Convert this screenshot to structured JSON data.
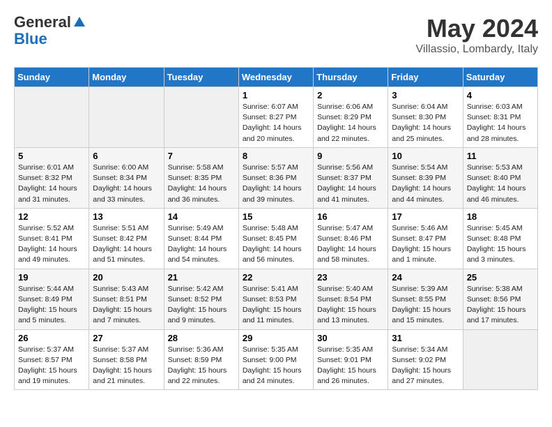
{
  "header": {
    "logo_general": "General",
    "logo_blue": "Blue",
    "month": "May 2024",
    "location": "Villassio, Lombardy, Italy"
  },
  "columns": [
    "Sunday",
    "Monday",
    "Tuesday",
    "Wednesday",
    "Thursday",
    "Friday",
    "Saturday"
  ],
  "weeks": [
    [
      {
        "day": "",
        "info": ""
      },
      {
        "day": "",
        "info": ""
      },
      {
        "day": "",
        "info": ""
      },
      {
        "day": "1",
        "info": "Sunrise: 6:07 AM\nSunset: 8:27 PM\nDaylight: 14 hours\nand 20 minutes."
      },
      {
        "day": "2",
        "info": "Sunrise: 6:06 AM\nSunset: 8:29 PM\nDaylight: 14 hours\nand 22 minutes."
      },
      {
        "day": "3",
        "info": "Sunrise: 6:04 AM\nSunset: 8:30 PM\nDaylight: 14 hours\nand 25 minutes."
      },
      {
        "day": "4",
        "info": "Sunrise: 6:03 AM\nSunset: 8:31 PM\nDaylight: 14 hours\nand 28 minutes."
      }
    ],
    [
      {
        "day": "5",
        "info": "Sunrise: 6:01 AM\nSunset: 8:32 PM\nDaylight: 14 hours\nand 31 minutes."
      },
      {
        "day": "6",
        "info": "Sunrise: 6:00 AM\nSunset: 8:34 PM\nDaylight: 14 hours\nand 33 minutes."
      },
      {
        "day": "7",
        "info": "Sunrise: 5:58 AM\nSunset: 8:35 PM\nDaylight: 14 hours\nand 36 minutes."
      },
      {
        "day": "8",
        "info": "Sunrise: 5:57 AM\nSunset: 8:36 PM\nDaylight: 14 hours\nand 39 minutes."
      },
      {
        "day": "9",
        "info": "Sunrise: 5:56 AM\nSunset: 8:37 PM\nDaylight: 14 hours\nand 41 minutes."
      },
      {
        "day": "10",
        "info": "Sunrise: 5:54 AM\nSunset: 8:39 PM\nDaylight: 14 hours\nand 44 minutes."
      },
      {
        "day": "11",
        "info": "Sunrise: 5:53 AM\nSunset: 8:40 PM\nDaylight: 14 hours\nand 46 minutes."
      }
    ],
    [
      {
        "day": "12",
        "info": "Sunrise: 5:52 AM\nSunset: 8:41 PM\nDaylight: 14 hours\nand 49 minutes."
      },
      {
        "day": "13",
        "info": "Sunrise: 5:51 AM\nSunset: 8:42 PM\nDaylight: 14 hours\nand 51 minutes."
      },
      {
        "day": "14",
        "info": "Sunrise: 5:49 AM\nSunset: 8:44 PM\nDaylight: 14 hours\nand 54 minutes."
      },
      {
        "day": "15",
        "info": "Sunrise: 5:48 AM\nSunset: 8:45 PM\nDaylight: 14 hours\nand 56 minutes."
      },
      {
        "day": "16",
        "info": "Sunrise: 5:47 AM\nSunset: 8:46 PM\nDaylight: 14 hours\nand 58 minutes."
      },
      {
        "day": "17",
        "info": "Sunrise: 5:46 AM\nSunset: 8:47 PM\nDaylight: 15 hours\nand 1 minute."
      },
      {
        "day": "18",
        "info": "Sunrise: 5:45 AM\nSunset: 8:48 PM\nDaylight: 15 hours\nand 3 minutes."
      }
    ],
    [
      {
        "day": "19",
        "info": "Sunrise: 5:44 AM\nSunset: 8:49 PM\nDaylight: 15 hours\nand 5 minutes."
      },
      {
        "day": "20",
        "info": "Sunrise: 5:43 AM\nSunset: 8:51 PM\nDaylight: 15 hours\nand 7 minutes."
      },
      {
        "day": "21",
        "info": "Sunrise: 5:42 AM\nSunset: 8:52 PM\nDaylight: 15 hours\nand 9 minutes."
      },
      {
        "day": "22",
        "info": "Sunrise: 5:41 AM\nSunset: 8:53 PM\nDaylight: 15 hours\nand 11 minutes."
      },
      {
        "day": "23",
        "info": "Sunrise: 5:40 AM\nSunset: 8:54 PM\nDaylight: 15 hours\nand 13 minutes."
      },
      {
        "day": "24",
        "info": "Sunrise: 5:39 AM\nSunset: 8:55 PM\nDaylight: 15 hours\nand 15 minutes."
      },
      {
        "day": "25",
        "info": "Sunrise: 5:38 AM\nSunset: 8:56 PM\nDaylight: 15 hours\nand 17 minutes."
      }
    ],
    [
      {
        "day": "26",
        "info": "Sunrise: 5:37 AM\nSunset: 8:57 PM\nDaylight: 15 hours\nand 19 minutes."
      },
      {
        "day": "27",
        "info": "Sunrise: 5:37 AM\nSunset: 8:58 PM\nDaylight: 15 hours\nand 21 minutes."
      },
      {
        "day": "28",
        "info": "Sunrise: 5:36 AM\nSunset: 8:59 PM\nDaylight: 15 hours\nand 22 minutes."
      },
      {
        "day": "29",
        "info": "Sunrise: 5:35 AM\nSunset: 9:00 PM\nDaylight: 15 hours\nand 24 minutes."
      },
      {
        "day": "30",
        "info": "Sunrise: 5:35 AM\nSunset: 9:01 PM\nDaylight: 15 hours\nand 26 minutes."
      },
      {
        "day": "31",
        "info": "Sunrise: 5:34 AM\nSunset: 9:02 PM\nDaylight: 15 hours\nand 27 minutes."
      },
      {
        "day": "",
        "info": ""
      }
    ]
  ]
}
